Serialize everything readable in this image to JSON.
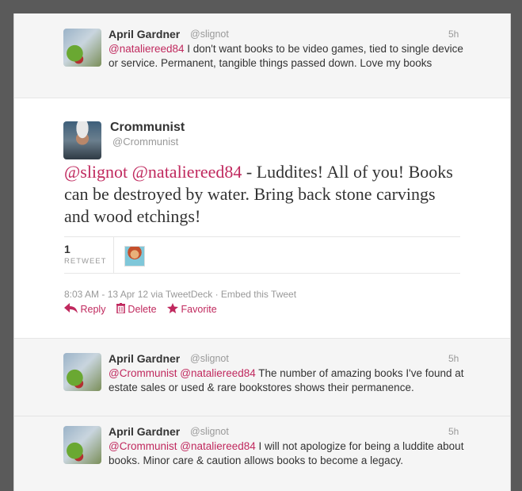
{
  "tweets_above": [
    {
      "name": "April Gardner",
      "handle": "@slignot",
      "time": "5h",
      "mention1": "@nataliereed84",
      "body": " I don't want books to be video games, tied to single device or service. Permanent, tangible things passed down. Love my books"
    }
  ],
  "main_tweet": {
    "name": "Crommunist",
    "handle": "@Crommunist",
    "mention1": "@slignot",
    "mention2": "@nataliereed84",
    "body": " - Luddites! All of you! Books can be destroyed by water. Bring back stone carvings and wood etchings!",
    "retweet_count": "1",
    "retweet_label": "RETWEET",
    "timestamp": "8:03 AM - 13 Apr 12 via TweetDeck",
    "embed_label": "Embed this Tweet",
    "actions": {
      "reply": "Reply",
      "delete": "Delete",
      "favorite": "Favorite"
    }
  },
  "replies": [
    {
      "name": "April Gardner",
      "handle": "@slignot",
      "time": "5h",
      "mention1": "@Crommunist",
      "mention2": "@nataliereed84",
      "body": " The number of amazing books I've found at estate sales or used & rare bookstores shows their permanence."
    },
    {
      "name": "April Gardner",
      "handle": "@slignot",
      "time": "5h",
      "mention1": "@Crommunist",
      "mention2": "@nataliereed84",
      "body": " I will not apologize for being a luddite about books. Minor care & caution allows books to become a legacy."
    }
  ],
  "colors": {
    "accent": "#c0295e",
    "muted": "#999999",
    "background": "#f5f5f5",
    "page": "#5a5a5a"
  }
}
